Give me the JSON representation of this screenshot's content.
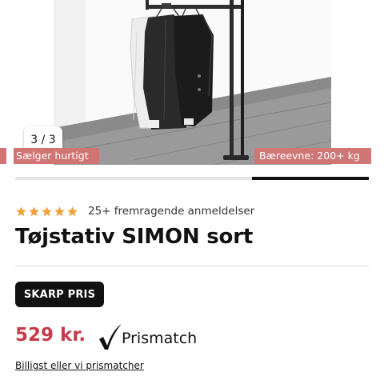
{
  "gallery": {
    "counter": "3 / 3",
    "tags": {
      "prev_fragment": "",
      "sells_fast": "Sælger hurtigt",
      "capacity": "Bæreevne: 200+ kg"
    },
    "progress": 0.33,
    "image": "black-clothing-rack-with-garments-photo"
  },
  "rating": {
    "stars": 5,
    "star_color": "#f0a13c",
    "text": "25+ fremragende anmeldelser"
  },
  "product": {
    "title": "Tøjstativ SIMON sort"
  },
  "badge": {
    "label": "SKARP PRIS"
  },
  "pricing": {
    "price": "529 kr.",
    "price_color": "#c73a4a",
    "prismatch_icon": "checkmark-icon",
    "prismatch_label": "Prismatch",
    "note": "Billigst eller vi prismatcher"
  }
}
